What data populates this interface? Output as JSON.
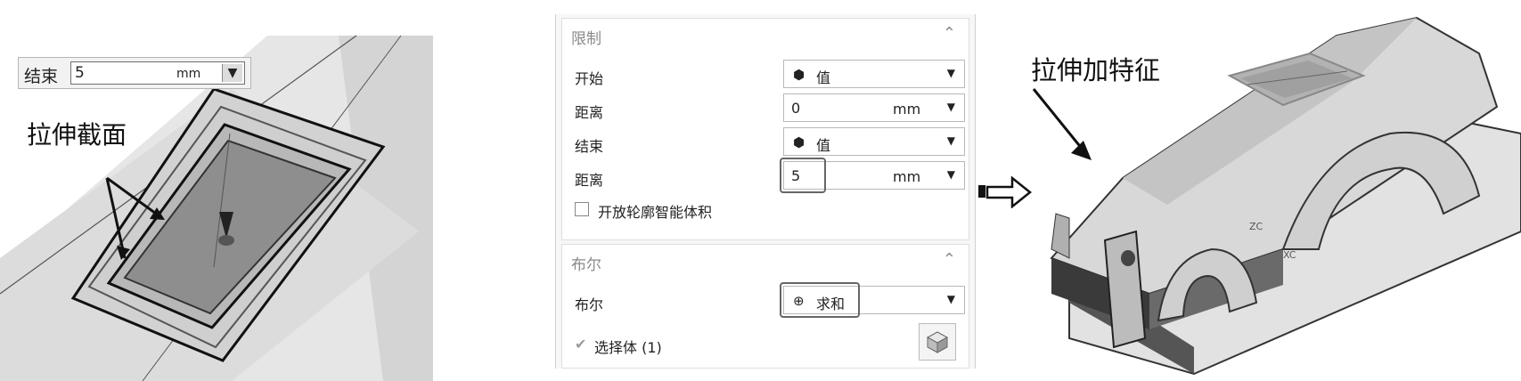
{
  "left_view": {
    "end_label": "结束",
    "end_value": "5",
    "end_unit": "mm",
    "annotation": "拉伸截面"
  },
  "dialog": {
    "limits": {
      "header": "限制",
      "start_label": "开始",
      "start_value": "值",
      "start_distance_label": "距离",
      "start_distance_value": "0",
      "start_distance_unit": "mm",
      "end_label": "结束",
      "end_value": "值",
      "end_distance_label": "距离",
      "end_distance_value": "5",
      "end_distance_unit": "mm",
      "open_profile_label": "开放轮廓智能体积"
    },
    "boolean": {
      "header": "布尔",
      "boolean_label": "布尔",
      "boolean_value": "求和",
      "select_body_label": "选择体 (1)"
    }
  },
  "right_view": {
    "annotation": "拉伸加特征",
    "axis_label_zc": "ZC",
    "axis_label_xc": "XC"
  },
  "icons": [
    "dropdown-arrow-icon",
    "chevron-up-icon",
    "value-cube-icon",
    "unite-icon",
    "check-icon",
    "solid-body-icon",
    "right-arrow-icon"
  ]
}
